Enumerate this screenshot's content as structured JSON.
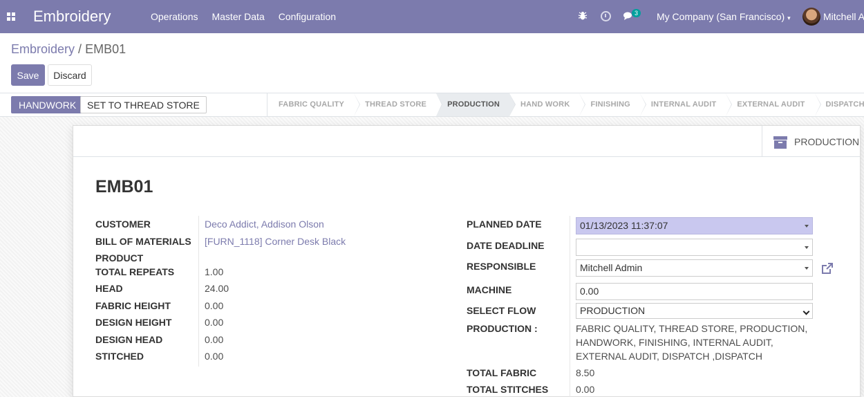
{
  "navbar": {
    "app_name": "Embroidery",
    "menu": [
      "Operations",
      "Master Data",
      "Configuration"
    ],
    "messages_count": "3",
    "company": "My Company (San Francisco)",
    "user": "Mitchell Admin",
    "bg_color": "#7c7bad"
  },
  "breadcrumb": {
    "parent": "Embroidery",
    "separator": "/",
    "current": "EMB01"
  },
  "actions": {
    "save": "Save",
    "discard": "Discard"
  },
  "statusbar": {
    "buttons": [
      "HANDWORK",
      "SET TO THREAD STORE"
    ],
    "stages": [
      "FABRIC QUALITY",
      "THREAD STORE",
      "PRODUCTION",
      "HAND WORK",
      "FINISHING",
      "INTERNAL AUDIT",
      "EXTERNAL AUDIT",
      "DISPATCH"
    ],
    "active_stage": "PRODUCTION"
  },
  "smart_button": {
    "label": "PRODUCTION",
    "icon": "archive-icon"
  },
  "record": {
    "title": "EMB01",
    "left": {
      "customer_label": "CUSTOMER",
      "customer": "Deco Addict, Addison Olson",
      "bom_label": "BILL OF MATERIALS",
      "bom": "[FURN_1118] Corner Desk Black",
      "product_label": "PRODUCT",
      "repeats_label": "TOTAL REPEATS",
      "repeats": "1.00",
      "head_label": "HEAD",
      "head": "24.00",
      "fabric_height_label": "FABRIC HEIGHT",
      "fabric_height": "0.00",
      "design_height_label": "DESIGN HEIGHT",
      "design_height": "0.00",
      "design_head_label": "DESIGN HEAD",
      "design_head": "0.00",
      "stitched_label": "STITCHED",
      "stitched": "0.00"
    },
    "right": {
      "planned_date_label": "PLANNED DATE",
      "planned_date": "01/13/2023 11:37:07",
      "deadline_label": "DATE DEADLINE",
      "deadline": "",
      "responsible_label": "RESPONSIBLE",
      "responsible": "Mitchell Admin",
      "machine_label": "MACHINE",
      "machine": "0.00",
      "flow_label": "SELECT FLOW",
      "flow": "PRODUCTION",
      "production_label": "PRODUCTION :",
      "production_text": "FABRIC QUALITY, THREAD STORE, PRODUCTION, HANDWORK, FINISHING, INTERNAL AUDIT, EXTERNAL AUDIT, DISPATCH ,DISPATCH",
      "total_fabric_label": "TOTAL FABRIC",
      "total_fabric": "8.50",
      "total_stitches_label": "TOTAL STITCHES",
      "total_stitches": "0.00"
    }
  }
}
